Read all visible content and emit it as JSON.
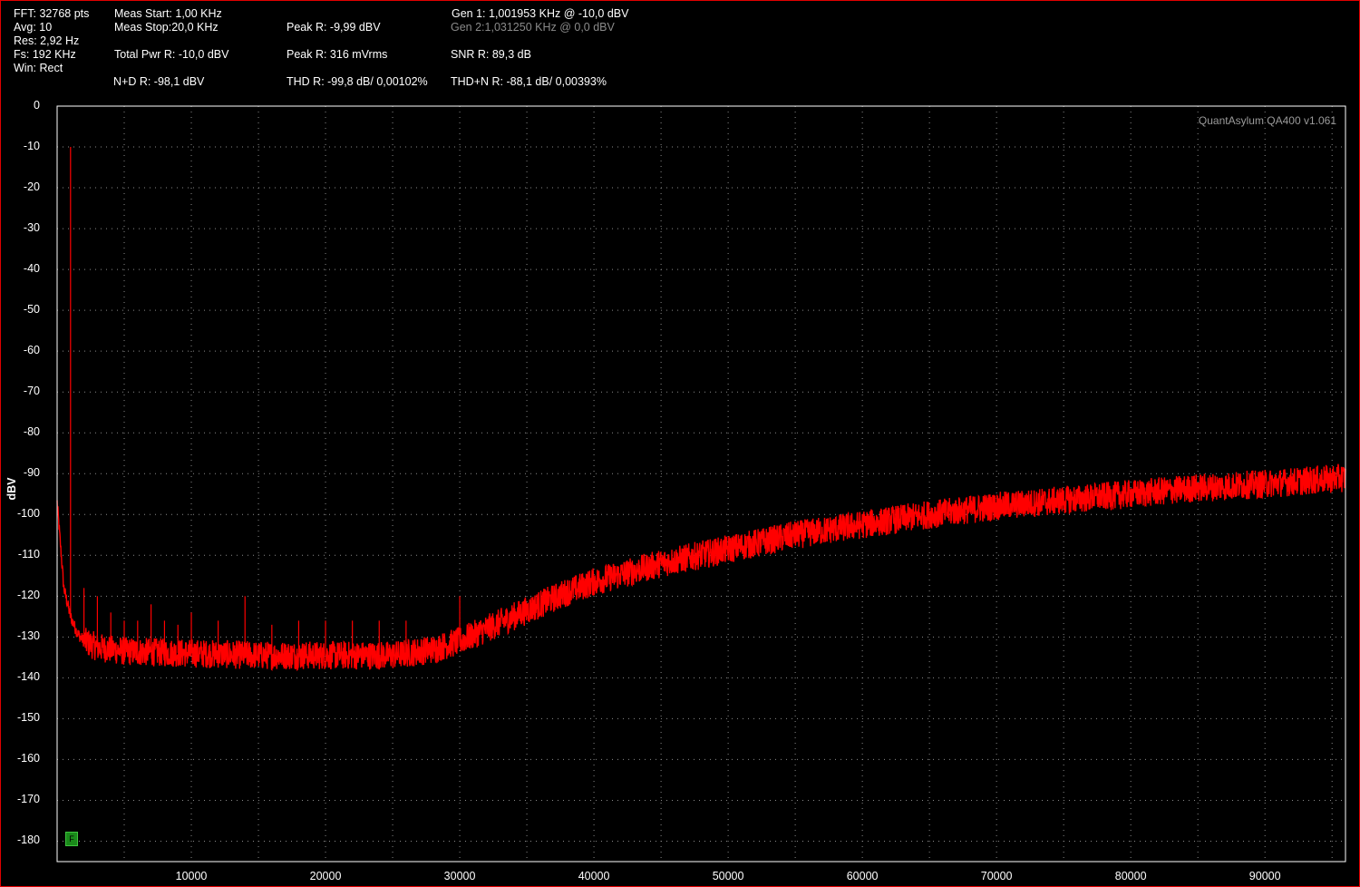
{
  "header": {
    "col1": [
      "FFT: 32768 pts",
      "Avg: 10",
      "Res: 2,92 Hz",
      "Fs: 192 KHz",
      "Win: Rect"
    ],
    "meas_start": "Meas Start: 1,00 KHz",
    "meas_stop": "Meas Stop:20,0 KHz",
    "total_pwr": "Total Pwr R: -10,0 dBV",
    "nd": "N+D R: -98,1 dBV",
    "peak_dbv": "Peak R: -9,99 dBV",
    "peak_mvrms": "Peak R: 316 mVrms",
    "thd": "THD R: -99,8 dB/ 0,00102%",
    "gen1": "Gen 1: 1,001953 KHz @ -10,0  dBV",
    "gen2": "Gen 2:1,031250 KHz @ 0,0  dBV",
    "snr": "SNR R: 89,3 dB",
    "thdn": "THD+N R: -88,1 dB/ 0,00393%"
  },
  "watermark": "QuantAsylum QA400 v1.061",
  "marker_label": "F",
  "chart_data": {
    "type": "line",
    "title": "",
    "xlabel": "",
    "ylabel": "dBV",
    "xlim": [
      0,
      96000
    ],
    "ylim": [
      -185,
      0
    ],
    "x_ticks": [
      10000,
      20000,
      30000,
      40000,
      50000,
      60000,
      70000,
      80000,
      90000
    ],
    "x_tick_labels": [
      "10000",
      "20000",
      "30000",
      "40000",
      "50000",
      "60000",
      "70000",
      "80000",
      "90000"
    ],
    "y_ticks": [
      0,
      -10,
      -20,
      -30,
      -40,
      -50,
      -60,
      -70,
      -80,
      -90,
      -100,
      -110,
      -120,
      -130,
      -140,
      -150,
      -160,
      -170,
      -180
    ],
    "y_tick_labels": [
      "0",
      "-10",
      "-20",
      "-30",
      "-40",
      "-50",
      "-60",
      "-70",
      "-80",
      "-90",
      "-100",
      "-110",
      "-120",
      "-130",
      "-140",
      "-150",
      "-160",
      "-170",
      "-180"
    ],
    "grid": true,
    "colors": {
      "trace": "#ff0000",
      "grid": "#8a8a8a",
      "frame": "#e00000"
    },
    "series": [
      {
        "noise_floor": {
          "x": [
            0,
            500,
            1000,
            1500,
            2000,
            3000,
            5000,
            10000,
            15000,
            20000,
            25000,
            28000,
            30000,
            32000,
            35000,
            38000,
            40000,
            45000,
            50000,
            55000,
            60000,
            65000,
            70000,
            75000,
            80000,
            85000,
            90000,
            96000
          ],
          "y": [
            -97,
            -118,
            -125,
            -129,
            -131,
            -132.5,
            -133.5,
            -134,
            -134.5,
            -134.5,
            -134.5,
            -133,
            -131,
            -128,
            -123.5,
            -119,
            -116.5,
            -112,
            -108.5,
            -105,
            -102.5,
            -100,
            -98,
            -96.5,
            -95,
            -93.5,
            -92.5,
            -91
          ]
        },
        "spikes": {
          "x": [
            1000,
            2000,
            3000,
            4000,
            5000,
            6000,
            7000,
            8000,
            9000,
            10000,
            12000,
            14000,
            16000,
            18000,
            20000,
            22000,
            24000,
            26000,
            30000
          ],
          "y": [
            -10,
            -118,
            -120,
            -124,
            -126,
            -126,
            -122,
            -126,
            -127,
            -124,
            -126,
            -120,
            -127,
            -126,
            -126,
            -126,
            -126,
            -126,
            -120
          ]
        }
      }
    ]
  }
}
